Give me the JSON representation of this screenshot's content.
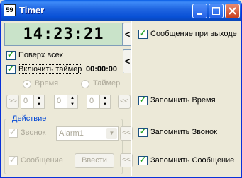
{
  "window": {
    "title": "Timer",
    "icon_text": "59"
  },
  "clock": {
    "time": "14:23:21"
  },
  "arrows": {
    "collapse": "<",
    "shift_right": ">>",
    "shift_left": "<<"
  },
  "options": {
    "always_on_top": {
      "label": "Поверх всех",
      "checked": true
    },
    "enable_timer": {
      "label": "Включить таймер",
      "value": "00:00:00",
      "checked": true
    }
  },
  "mode": {
    "time_label": "Время",
    "time_selected": true,
    "timer_label": "Таймер",
    "timer_selected": false
  },
  "spinners": [
    "0",
    "0",
    "0"
  ],
  "action_group": {
    "title": "Действие",
    "sound": {
      "label": "Звонок",
      "checked": true,
      "selected": "Alarm1"
    },
    "message": {
      "label": "Сообщение",
      "checked": true,
      "button": "Ввести"
    }
  },
  "right_panel": {
    "message_on_exit": {
      "label": "Сообщение при выходе",
      "checked": true
    },
    "remember_time": {
      "label": "Запомнить Время",
      "checked": true
    },
    "remember_sound": {
      "label": "Запомнить Звонок",
      "checked": true
    },
    "remember_message": {
      "label": "Запомнить Сообщение",
      "checked": true
    }
  }
}
